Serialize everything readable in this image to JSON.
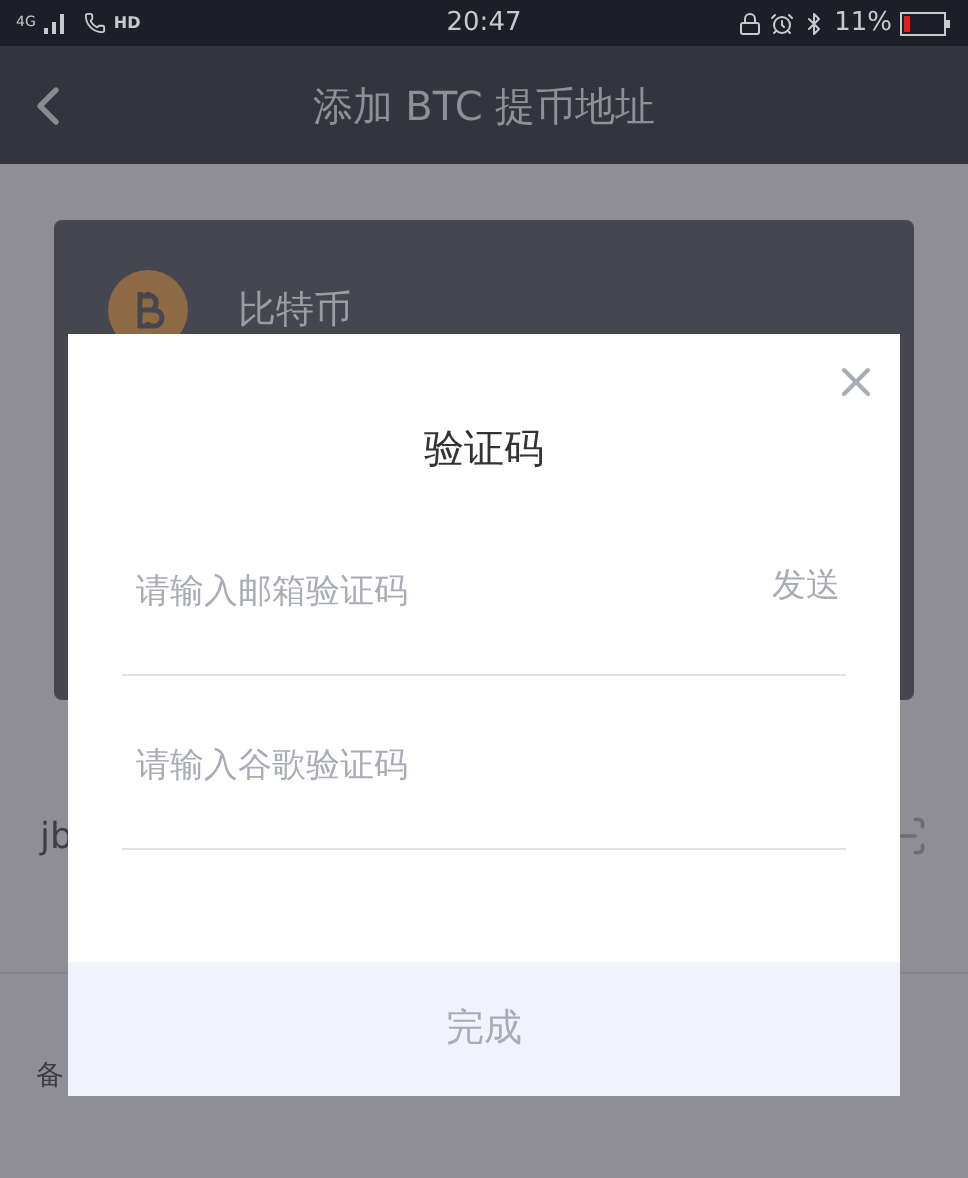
{
  "status_bar": {
    "network": "4G",
    "call": "HD",
    "time": "20:47",
    "battery": "11%"
  },
  "header": {
    "title": "添加 BTC 提币地址"
  },
  "background": {
    "coin_name": "比特币",
    "address_text": "jb",
    "note_text": "备"
  },
  "dialog": {
    "title": "验证码",
    "fields": [
      {
        "placeholder": "请输入邮箱验证码",
        "action": "发送"
      },
      {
        "placeholder": "请输入谷歌验证码"
      }
    ],
    "confirm": "完成"
  }
}
